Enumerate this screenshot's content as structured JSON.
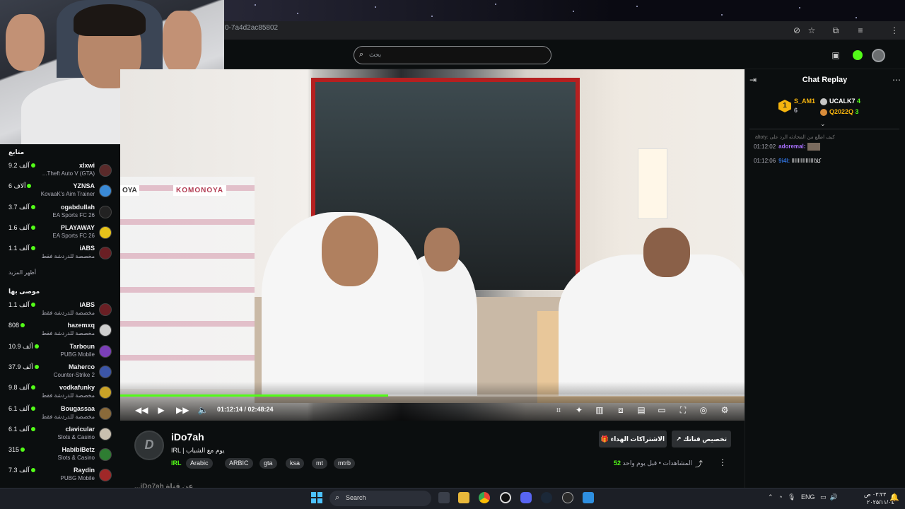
{
  "browser": {
    "url_fragment": "0-7a4d2ac85802"
  },
  "search": {
    "placeholder": "بحث"
  },
  "sidebar": {
    "following_title": "متابع",
    "show_more": "أظهر المزيد",
    "recommended_title": "موصى بها",
    "following": [
      {
        "name": "xlxwi",
        "game": "Grand Theft Auto V (GTA)",
        "game_display": "...Theft Auto V (GTA)",
        "viewers": "9.2 آلف",
        "avatar_color": "#5a2a2a"
      },
      {
        "name": "YZNSA",
        "game": "KovaaK's Aim Trainer",
        "viewers": "6 آلاف",
        "avatar_color": "#3a8ad6"
      },
      {
        "name": "ogabdullah",
        "game": "EA Sports FC 26",
        "viewers": "3.7 آلف",
        "avatar_color": "#222222"
      },
      {
        "name": "PLAYAWAY",
        "game": "EA Sports FC 26",
        "viewers": "1.6 آلف",
        "avatar_color": "#e6c21a"
      },
      {
        "name": "iABS",
        "game": "مخصصة للدردشة فقط",
        "viewers": "1.1 آلف",
        "avatar_color": "#6a1f24"
      }
    ],
    "recommended": [
      {
        "name": "iABS",
        "game": "مخصصة للدردشة فقط",
        "viewers": "1.1 آلف",
        "avatar_color": "#6a1f24"
      },
      {
        "name": "hazemxq",
        "game": "مخصصة للدردشة فقط",
        "viewers": "808",
        "avatar_color": "#cfcfcf"
      },
      {
        "name": "Tarboun",
        "game": "PUBG Mobile",
        "viewers": "10.9 آلف",
        "avatar_color": "#7b3fb8"
      },
      {
        "name": "Maherco",
        "game": "Counter-Strike 2",
        "viewers": "37.9 آلف",
        "avatar_color": "#3c56a8"
      },
      {
        "name": "vodkafunky",
        "game": "مخصصة للدردشة فقط",
        "viewers": "9.8 آلف",
        "avatar_color": "#c9a227"
      },
      {
        "name": "Bougassaa",
        "game": "مخصصة للدردشة فقط",
        "viewers": "6.1 آلف",
        "avatar_color": "#8a6a3a"
      },
      {
        "name": "clavicular",
        "game": "Slots & Casino",
        "viewers": "6.1 آلف",
        "avatar_color": "#c9c0b0"
      },
      {
        "name": "HabibiBetz",
        "game": "Slots & Casino",
        "viewers": "315",
        "avatar_color": "#2e7d32"
      },
      {
        "name": "Raydin",
        "game": "PUBG Mobile",
        "viewers": "7.3 آلف",
        "avatar_color": "#a02828"
      }
    ]
  },
  "video": {
    "sign_left": "OYA",
    "sign_store": "KOMONOYA",
    "current_time": "01:12:14",
    "duration": "02:48:24",
    "time_display": "01:12:14 / 02:48:24",
    "progress_fraction": 0.429
  },
  "channel": {
    "name": "iDo7ah",
    "avatar_letter": "D",
    "title": "IRL | يوم مع الشباب",
    "category": "IRL",
    "tags": [
      "Arabic",
      "ARBIC",
      "gta",
      "ksa",
      "mt",
      "mtrb"
    ],
    "subscribe_gift_label": "الاشتراكات الهداء",
    "clip_label": "تخصيص قناتك",
    "views_count": "52",
    "views_label": "المشاهدات",
    "time_ago": "قبل يوم واحد",
    "description_peek": "...iDo7ah عن قناة"
  },
  "chat": {
    "title": "Chat Replay",
    "top_gifters": [
      {
        "name": "S_AM1",
        "count": "6",
        "color": "#f6b40e"
      },
      {
        "name": "UCALK7",
        "count": "4",
        "color": "#f6b40e"
      },
      {
        "name": "Q2022Q",
        "count": "3",
        "color": "#f6b40e"
      }
    ],
    "gold_rank": "1",
    "messages": [
      {
        "reply_preview": "altoty: كيف اطلع من المحادثه الرد على",
        "time": "01:12:02",
        "user": "adoremal:",
        "text": "",
        "user_color": "#a970ff"
      },
      {
        "time": "01:12:06",
        "user": "9i4l:",
        "text": "كلاااااااااااااااا",
        "user_color": "#2f6fd6"
      }
    ]
  },
  "taskbar": {
    "search_label": "Search",
    "language": "ENG",
    "clock_time": "٠٣:٢٣ ص",
    "clock_date": "٢٠٢٥/١١/٠٤",
    "apps": [
      "start-icon",
      "file-explorer-icon",
      "folder-icon",
      "chrome-icon",
      "app-icon",
      "discord-icon",
      "steam-icon",
      "obs-icon",
      "store-icon"
    ]
  }
}
